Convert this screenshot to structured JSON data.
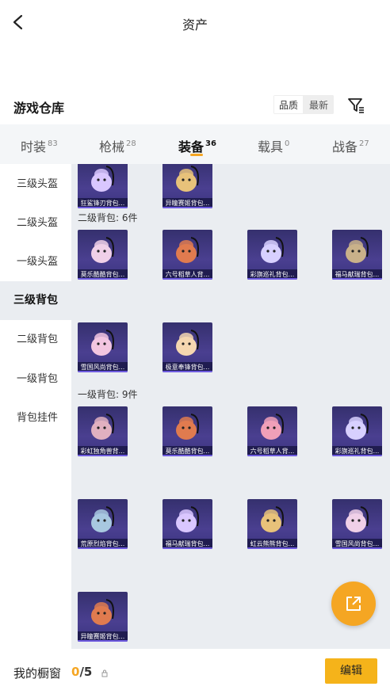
{
  "header": {
    "title": "资产"
  },
  "warehouse": {
    "title": "游戏仓库",
    "sort_options": [
      "品质",
      "最新"
    ]
  },
  "tabs": [
    {
      "label": "时装",
      "count": "83"
    },
    {
      "label": "枪械",
      "count": "28"
    },
    {
      "label": "装备",
      "count": "36"
    },
    {
      "label": "载具",
      "count": "0"
    },
    {
      "label": "战备",
      "count": "27"
    }
  ],
  "sidebar": {
    "items": [
      {
        "label": "三级头盔"
      },
      {
        "label": "二级头盔"
      },
      {
        "label": "一级头盔"
      },
      {
        "label": "三级背包"
      },
      {
        "label": "二级背包"
      },
      {
        "label": "一级背包"
      },
      {
        "label": "背包挂件"
      }
    ]
  },
  "groups": [
    {
      "label": "",
      "items": [
        "狂鲨锋刃背包...",
        "异瞳赛姬背包..."
      ]
    },
    {
      "label": "二级背包: 6件",
      "items": [
        "莫乐酷酷背包...",
        "六号稻草人背...",
        "彩旗巡礼背包...",
        "福马献瑞背包...",
        "雪国风尚背包...",
        "极意奉锋背包..."
      ]
    },
    {
      "label": "一级背包: 9件",
      "items": [
        "彩虹独角兽背...",
        "莫乐酷酷背包...",
        "六号稻草人背...",
        "彩旗巡礼背包...",
        "荒原烈焰背包...",
        "福马献瑞背包...",
        "虹云熊熊背包...",
        "雪国风尚背包...",
        "异瞳赛姬背包..."
      ]
    }
  ],
  "colors": {
    "accent": "#f5a623",
    "card_bg": "#3b3480"
  },
  "bottom": {
    "showcase_label": "我的橱窗",
    "showcase_current": "0",
    "showcase_total": "/5",
    "edit_label": "编辑"
  }
}
